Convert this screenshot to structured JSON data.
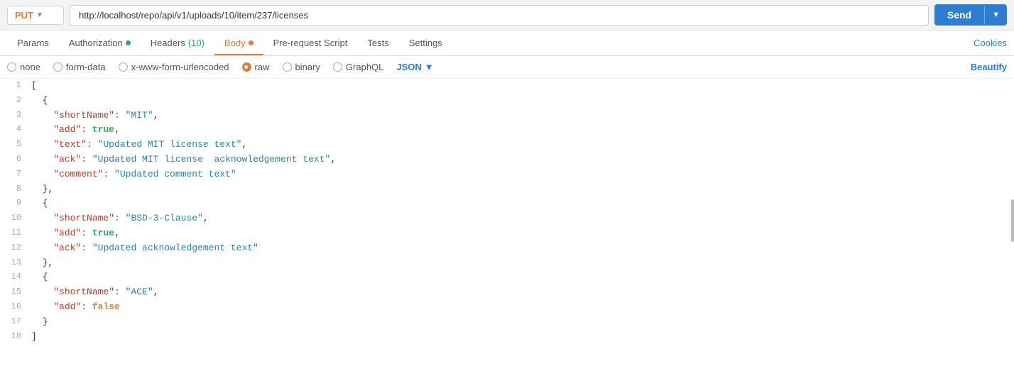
{
  "topbar": {
    "method": "PUT",
    "url": "http://localhost/repo/api/v1/uploads/10/item/237/licenses",
    "send_label": "Send"
  },
  "tabs": {
    "items": [
      {
        "id": "params",
        "label": "Params",
        "dot": null,
        "count": null
      },
      {
        "id": "authorization",
        "label": "Authorization",
        "dot": "green",
        "count": null
      },
      {
        "id": "headers",
        "label": "Headers",
        "dot": null,
        "count": "(10)",
        "count_color": "green"
      },
      {
        "id": "body",
        "label": "Body",
        "dot": "orange",
        "count": null,
        "active": true
      },
      {
        "id": "pre-request",
        "label": "Pre-request Script",
        "dot": null,
        "count": null
      },
      {
        "id": "tests",
        "label": "Tests",
        "dot": null,
        "count": null
      },
      {
        "id": "settings",
        "label": "Settings",
        "dot": null,
        "count": null
      }
    ],
    "cookies_label": "Cookies"
  },
  "body_types": [
    {
      "id": "none",
      "label": "none",
      "selected": false
    },
    {
      "id": "form-data",
      "label": "form-data",
      "selected": false
    },
    {
      "id": "x-www-form-urlencoded",
      "label": "x-www-form-urlencoded",
      "selected": false
    },
    {
      "id": "raw",
      "label": "raw",
      "selected": true
    },
    {
      "id": "binary",
      "label": "binary",
      "selected": false
    },
    {
      "id": "graphql",
      "label": "GraphQL",
      "selected": false
    }
  ],
  "json_label": "JSON",
  "beautify_label": "Beautify",
  "code_lines": [
    {
      "num": 1,
      "content": "["
    },
    {
      "num": 2,
      "content": "  {"
    },
    {
      "num": 3,
      "content": "    \"shortName\": \"MIT\","
    },
    {
      "num": 4,
      "content": "    \"add\": true,"
    },
    {
      "num": 5,
      "content": "    \"text\": \"Updated MIT license text\","
    },
    {
      "num": 6,
      "content": "    \"ack\": \"Updated MIT license  acknowledgement text\","
    },
    {
      "num": 7,
      "content": "    \"comment\": \"Updated comment text\""
    },
    {
      "num": 8,
      "content": "  },"
    },
    {
      "num": 9,
      "content": "  {"
    },
    {
      "num": 10,
      "content": "    \"shortName\": \"BSD-3-Clause\","
    },
    {
      "num": 11,
      "content": "    \"add\": true,"
    },
    {
      "num": 12,
      "content": "    \"ack\": \"Updated acknowledgement text\""
    },
    {
      "num": 13,
      "content": "  },"
    },
    {
      "num": 14,
      "content": "  {"
    },
    {
      "num": 15,
      "content": "    \"shortName\": \"ACE\","
    },
    {
      "num": 16,
      "content": "    \"add\": false"
    },
    {
      "num": 17,
      "content": "  }"
    },
    {
      "num": 18,
      "content": "]"
    }
  ]
}
